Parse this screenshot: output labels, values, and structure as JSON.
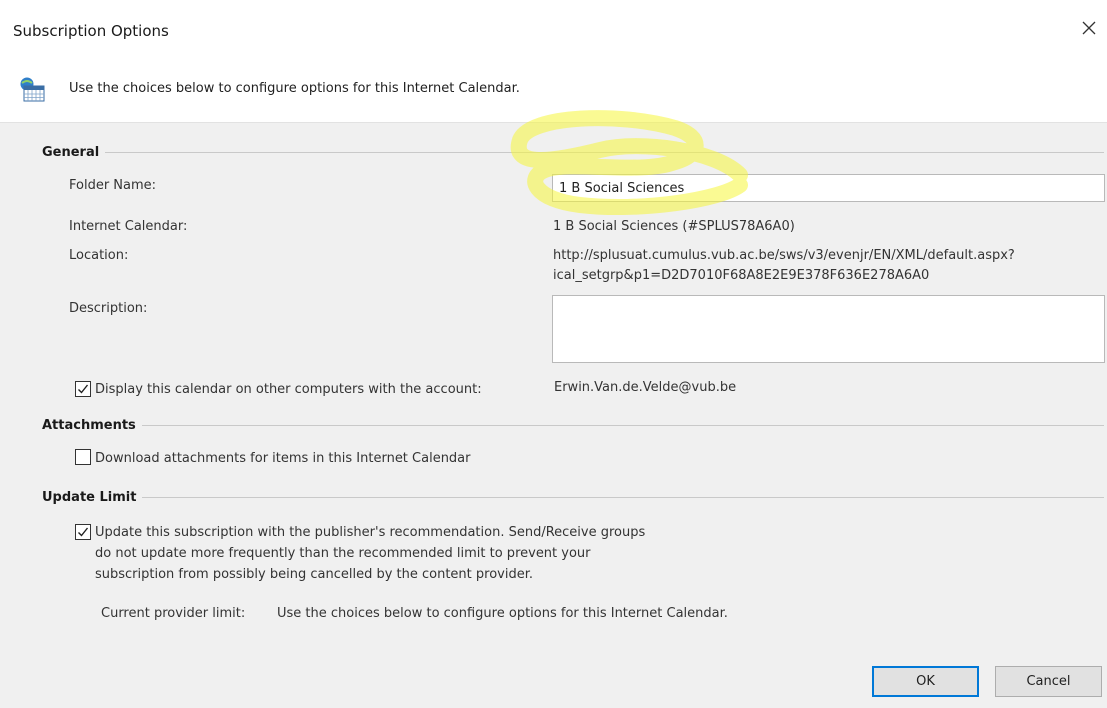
{
  "window": {
    "title": "Subscription Options",
    "close_icon": "close-icon"
  },
  "intro": {
    "icon": "calendar-icon",
    "text": "Use the choices below to configure options for this Internet Calendar."
  },
  "general": {
    "heading": "General",
    "folder_name_label": "Folder Name:",
    "folder_name_value": "1 B Social Sciences",
    "internet_calendar_label": "Internet Calendar:",
    "internet_calendar_value": "1 B Social Sciences (#SPLUS78A6A0)",
    "location_label": "Location:",
    "location_line1": "http://splusuat.cumulus.vub.ac.be/sws/v3/evenjr/EN/XML/default.aspx?",
    "location_line2": "ical_setgrp&p1=D2D7010F68A8E2E9E378F636E278A6A0",
    "description_label": "Description:",
    "description_value": "",
    "display_checkbox_label": "Display this calendar on other computers with the account:",
    "display_checked": true,
    "account": "Erwin.Van.de.Velde@vub.be"
  },
  "attachments": {
    "heading": "Attachments",
    "download_label": "Download attachments for items in this Internet Calendar",
    "download_checked": false
  },
  "update_limit": {
    "heading": "Update Limit",
    "update_line1": "Update this subscription with the publisher's recommendation. Send/Receive groups",
    "update_line2": "do not update more frequently than the recommended limit to prevent your",
    "update_line3": "subscription from possibly being cancelled by the content provider.",
    "update_checked": true,
    "current_limit_label": "Current provider limit:",
    "current_limit_value": "Use the choices below to configure options for this Internet Calendar."
  },
  "buttons": {
    "ok": "OK",
    "cancel": "Cancel"
  },
  "colors": {
    "panel_bg": "#f0f0f0",
    "default_button_border": "#0078d7",
    "highlight_marker": "#f5f53a"
  }
}
